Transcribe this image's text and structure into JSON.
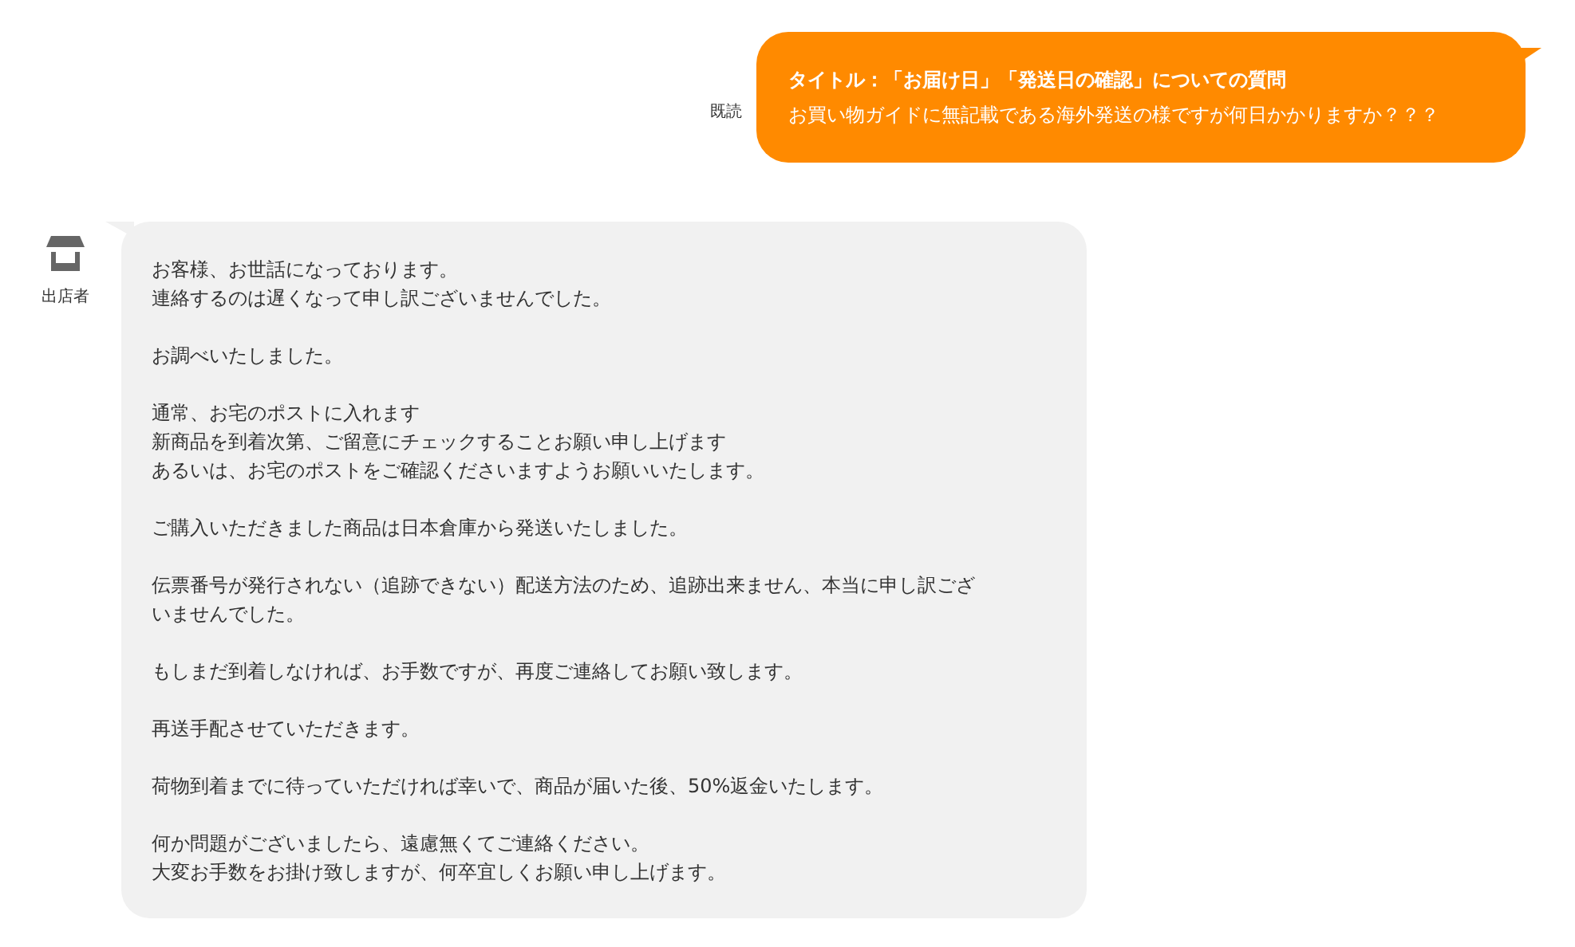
{
  "sent_message": {
    "read_status": "既読",
    "title": "タイトル：「お届け日」「発送日の確認」についての質問",
    "body": "お買い物ガイドに無記載である海外発送の様ですが何日かかりますか？？？"
  },
  "reply_message": {
    "sender": "出店者",
    "paragraphs": [
      {
        "lines": [
          "お客様、お世話になっております。",
          "連絡するのは遅くなって申し訳ございませんでした。"
        ]
      },
      {
        "lines": [
          "お調べいたしました。"
        ]
      },
      {
        "lines": [
          "通常、お宅のポストに入れます",
          "新商品を到着次第、ご留意にチェックすることお願い申し上げます",
          "あるいは、お宅のポストをご確認くださいますようお願いいたします。"
        ]
      },
      {
        "lines": [
          "ご購入いただきました商品は日本倉庫から発送いたしました。"
        ]
      },
      {
        "lines": [
          "伝票番号が発行されない（追跡できない）配送方法のため、追跡出来ません、本当に申し訳ござ",
          "いませんでした。"
        ]
      },
      {
        "lines": [
          "もしまだ到着しなければ、お手数ですが、再度ご連絡してお願い致します。"
        ]
      },
      {
        "lines": [
          "再送手配させていただきます。"
        ]
      },
      {
        "lines": [
          "荷物到着までに待っていただければ幸いで、商品が届いた後、50%返金いたします。"
        ]
      },
      {
        "lines": [
          "何か問題がございましたら、遠慮無くてご連絡ください。",
          "大変お手数をお掛け致しますが、何卒宜しくお願い申し上げます。"
        ]
      }
    ]
  }
}
